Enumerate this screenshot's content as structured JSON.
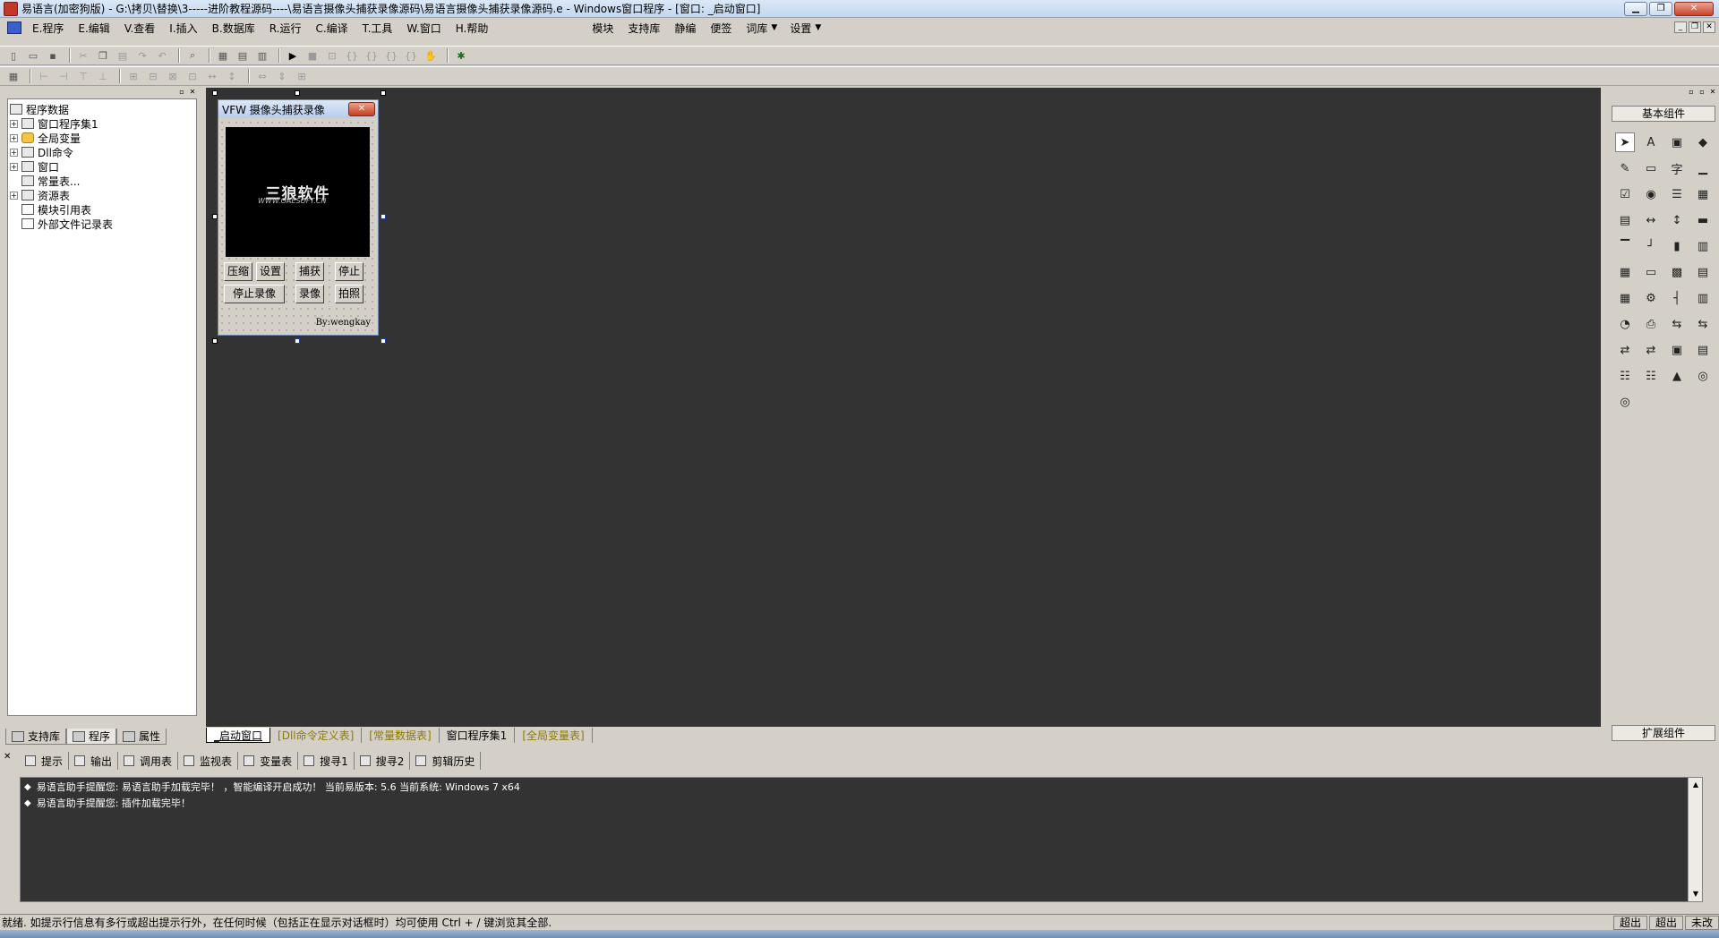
{
  "window": {
    "title": "易语言(加密狗版) - G:\\拷贝\\替换\\3-----进阶教程源码----\\易语言摄像头捕获录像源码\\易语言摄像头捕获录像源码.e - Windows窗口程序 - [窗口: _启动窗口]",
    "min": "▁",
    "max": "❐",
    "close": "✕"
  },
  "menu": {
    "items": [
      "E.程序",
      "E.编辑",
      "V.查看",
      "I.插入",
      "B.数据库",
      "R.运行",
      "C.编译",
      "T.工具",
      "W.窗口",
      "H.帮助"
    ],
    "extras": [
      "模块",
      "支持库",
      "静编",
      "便签",
      "词库",
      "设置"
    ],
    "dropdown_arrow": "▼"
  },
  "left_panel": {
    "tree": {
      "root": "程序数据",
      "items": [
        "窗口程序集1",
        "全局变量",
        "Dll命令",
        "窗口",
        "常量表...",
        "资源表",
        "模块引用表",
        "外部文件记录表"
      ],
      "expander": "+"
    },
    "tabs": [
      "支持库",
      "程序",
      "属性"
    ]
  },
  "form": {
    "title": "VFW 摄像头捕获录像",
    "close": "✕",
    "logo_text": "三狼软件",
    "logo_sub": "WWW.OAESOFT.CN",
    "buttons": [
      "压缩",
      "设置",
      "捕获",
      "停止",
      "停止录像",
      "录像",
      "拍照"
    ],
    "byline": "By:wengkay"
  },
  "center_tabs": [
    "_启动窗口",
    "[Dll命令定义表]",
    "[常量数据表]",
    "窗口程序集1",
    "[全局变量表]"
  ],
  "right_panel": {
    "title": "基本组件",
    "footer": "扩展组件",
    "components": [
      "pointer-icon",
      "label-icon",
      "picture-icon",
      "shape-icon",
      "edit-icon",
      "frame-icon",
      "text-icon",
      "line-icon",
      "checkbox-icon",
      "radio-icon",
      "list-icon",
      "grid-icon",
      "table-icon",
      "scroll-h-icon",
      "scroll-v-icon",
      "progress-icon",
      "ruler-icon",
      "slider-icon",
      "vslider-icon",
      "tabs-icon",
      "calendar-icon",
      "button-icon",
      "folder-icon",
      "doc-icon",
      "menu-icon",
      "net-icon",
      "splitter-icon",
      "db-icon",
      "timer-icon",
      "printer-icon",
      "serial-icon",
      "socket-icon",
      "client-icon",
      "server-icon",
      "browser-icon",
      "view-icon",
      "odbc-table-icon",
      "odbc-db-icon",
      "chart-icon",
      "odbc-icon",
      "odbc2-icon"
    ],
    "glyphs": [
      "➤",
      "A",
      "▣",
      "◆",
      "✎",
      "▭",
      "字",
      "▁",
      "☑",
      "◉",
      "☰",
      "▦",
      "▤",
      "↔",
      "↕",
      "▬",
      "▔",
      "┘",
      "▮",
      "▥",
      "▦",
      "▭",
      "▩",
      "▤",
      "▦",
      "⚙",
      "┤",
      "▥",
      "◔",
      "⎙",
      "⇆",
      "⇆",
      "⇄",
      "⇄",
      "▣",
      "▤",
      "☷",
      "☷",
      "▲",
      "◎",
      "◎"
    ]
  },
  "output": {
    "close": "✕",
    "tabs": [
      "提示",
      "输出",
      "调用表",
      "监视表",
      "变量表",
      "搜寻1",
      "搜寻2",
      "剪辑历史"
    ],
    "lines": [
      "易语言助手提醒您: 易语言助手加载完毕！ ，智能编译开启成功！ 当前易版本: 5.6  当前系统: Windows 7 x64",
      "易语言助手提醒您: 插件加载完毕！"
    ],
    "bullet": "◆"
  },
  "status": {
    "text": "就绪. 如提示行信息有多行或超出提示行外，在任何时候（包括正在显示对话框时）均可使用 Ctrl + / 键浏览其全部.",
    "cells": [
      "超出",
      "超出",
      "未改"
    ]
  }
}
